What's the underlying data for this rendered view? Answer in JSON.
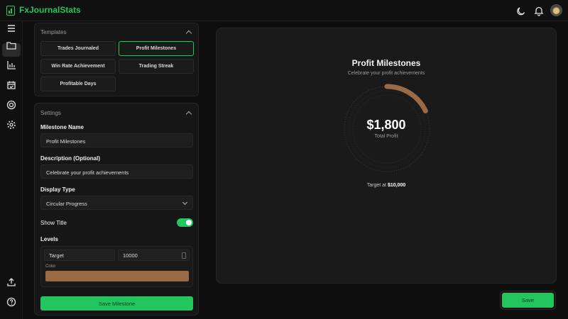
{
  "app": {
    "title": "FxJournalStats"
  },
  "header_icons": [
    "moon-icon",
    "bell-icon",
    "avatar"
  ],
  "rail_icons": [
    "menu-icon",
    "folder-icon",
    "bar-chart-icon",
    "calendar-check-icon",
    "target-icon",
    "gear-icon",
    "upload-icon",
    "help-icon"
  ],
  "templates": {
    "heading": "Templates",
    "buttons": [
      {
        "label": "Trades Journaled",
        "active": false
      },
      {
        "label": "Profit Milestones",
        "active": true
      },
      {
        "label": "Win Rate Achievement",
        "active": false
      },
      {
        "label": "Trading Streak",
        "active": false
      },
      {
        "label": "Profitable Days",
        "active": false
      }
    ]
  },
  "settings": {
    "heading": "Settings",
    "milestone_name_label": "Milestone Name",
    "milestone_name_value": "Profit Milestones",
    "description_label": "Description (Optional)",
    "description_value": "Celebrate your profit achievements",
    "display_type_label": "Display Type",
    "display_type_value": "Circular Progress",
    "show_title_label": "Show Title",
    "show_title_on": true,
    "levels_label": "Levels",
    "level": {
      "name": "Target",
      "value": "10000",
      "color_label": "Color",
      "color": "#9a6a44"
    },
    "save_label": "Save Milestone"
  },
  "preview": {
    "title": "Profit Milestones",
    "subtitle": "Celebrate your profit achievements",
    "value": "$1,800",
    "value_label": "Total Profit",
    "target_prefix": "Target at ",
    "target_value": "$10,000",
    "progress": 0.18,
    "color": "#9a6a44"
  },
  "save_button": "Save",
  "colors": {
    "accent": "#22c55e",
    "background": "#0e0e0e",
    "panel": "#161616"
  }
}
